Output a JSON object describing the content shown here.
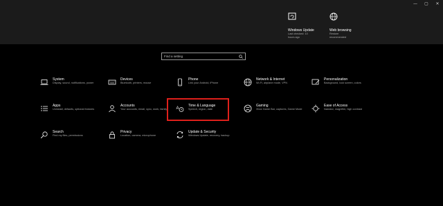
{
  "window_controls": {
    "minimize": "—",
    "maximize": "▢",
    "close": "✕"
  },
  "top_tiles": [
    {
      "title": "Windows Update",
      "lines": [
        "Last checked: 10",
        "hours ago"
      ],
      "icon": "windows-update-icon"
    },
    {
      "title": "Web browsing",
      "lines": [
        "Restore",
        "recommended"
      ],
      "icon": "globe-icon"
    }
  ],
  "search": {
    "placeholder": "Find a setting"
  },
  "categories": [
    {
      "title": "System",
      "desc": "Display, sound, notifications, power",
      "icon": "laptop-icon"
    },
    {
      "title": "Devices",
      "desc": "Bluetooth, printers, mouse",
      "icon": "keyboard-icon"
    },
    {
      "title": "Phone",
      "desc": "Link your Android, iPhone",
      "icon": "phone-icon"
    },
    {
      "title": "Network & Internet",
      "desc": "Wi-Fi, airplane mode, VPN",
      "icon": "globe-icon"
    },
    {
      "title": "Personalization",
      "desc": "Background, lock screen, colors",
      "icon": "paintbrush-icon"
    },
    {
      "title": "Apps",
      "desc": "Uninstall, defaults, optional features",
      "icon": "apps-list-icon"
    },
    {
      "title": "Accounts",
      "desc": "Your accounts, email, sync, work, family",
      "icon": "person-icon"
    },
    {
      "title": "Time & Language",
      "desc": "Speech, region, date",
      "icon": "time-language-icon"
    },
    {
      "title": "Gaming",
      "desc": "Xbox Game Bar, captures, Game Mode",
      "icon": "xbox-icon"
    },
    {
      "title": "Ease of Access",
      "desc": "Narrator, magnifier, high contrast",
      "icon": "ease-of-access-icon"
    },
    {
      "title": "Search",
      "desc": "Find my files, permissions",
      "icon": "search-icon"
    },
    {
      "title": "Privacy",
      "desc": "Location, camera, microphone",
      "icon": "lock-icon"
    },
    {
      "title": "Update & Security",
      "desc": "Windows Update, recovery, backup",
      "icon": "sync-icon"
    }
  ],
  "colors": {
    "highlight": "#e0201b",
    "background": "#000000",
    "top_band": "#1b1b1b"
  }
}
